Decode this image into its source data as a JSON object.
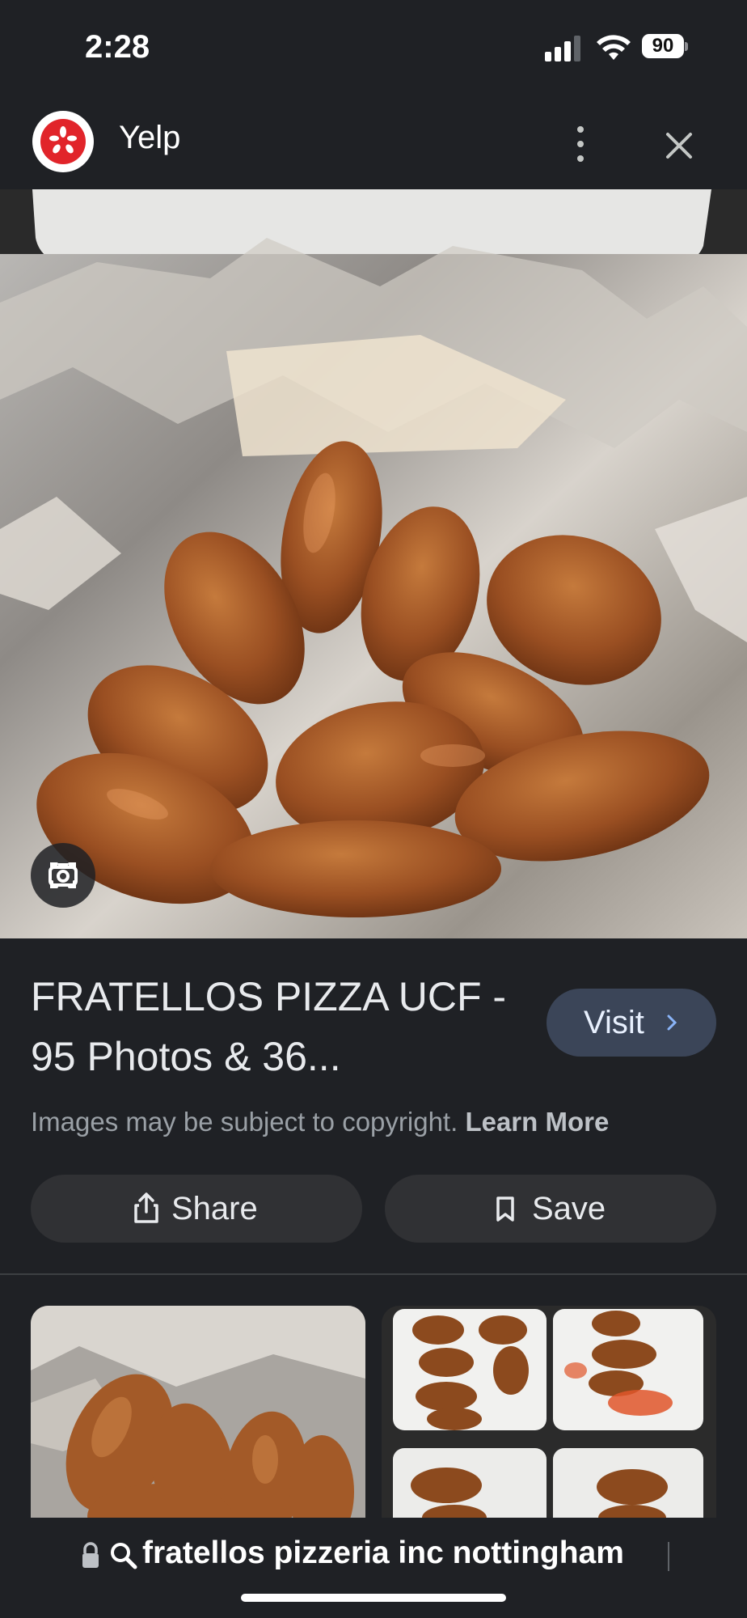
{
  "status_bar": {
    "time": "2:28",
    "battery": "90"
  },
  "header": {
    "site_name": "Yelp",
    "icons": [
      "yelp-logo",
      "more-vert-icon",
      "close-icon"
    ]
  },
  "hero": {
    "lens_icon": "lens-icon"
  },
  "result": {
    "title": "FRATELLOS PIZZA UCF - 95 Photos & 36...",
    "visit_label": "Visit",
    "copyright_text": "Images may be subject to copyright.",
    "learn_more": "Learn More"
  },
  "actions": {
    "share_label": "Share",
    "save_label": "Save"
  },
  "url_bar": {
    "text": "fratellos pizzeria inc nottingham"
  },
  "colors": {
    "background": "#1f2125",
    "visit_button": "#3b4558",
    "action_button": "#303134",
    "yelp_red": "#e1242a"
  }
}
